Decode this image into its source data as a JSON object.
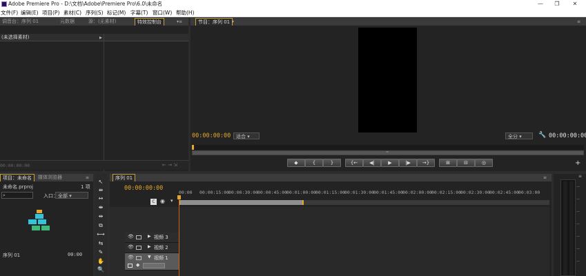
{
  "window": {
    "title": "Adobe Premiere Pro - D:\\文档\\Adobe\\Premiere Pro\\6.0\\未命名",
    "minimize": "—",
    "restore": "❐",
    "close": "✕"
  },
  "menu": [
    "文件(F)",
    "编辑(E)",
    "项目(P)",
    "素材(C)",
    "序列(S)",
    "标记(M)",
    "字幕(T)",
    "窗口(W)",
    "帮助(H)"
  ],
  "source_panel": {
    "tabs": [
      "调音台：序列 01",
      "元数据",
      "源：(无素材)",
      "特效控制台"
    ],
    "header": "(未选择素材)",
    "footer_tc": "00:00:00:00"
  },
  "program_monitor": {
    "tab": "节目：序列 01",
    "timecode_left": "00:00:00:00",
    "fit_dropdown": "适合",
    "quality_dropdown": "全分",
    "timecode_right": "00:00:00:00",
    "transport": [
      "◆",
      "{",
      "}",
      "{←",
      "◀|",
      "▶",
      "|▶",
      "→}",
      "⊞",
      "⊟",
      "◎"
    ]
  },
  "project_panel": {
    "tabs": [
      "项目：未命名",
      "媒体浏览器"
    ],
    "filename": "未命名.prproj",
    "count": "1 项",
    "search_placeholder": "",
    "entry_label": "入口：",
    "entry_value": "全部",
    "item_name": "序列 01",
    "item_duration": "00:00"
  },
  "tools": [
    "↖",
    "⇻",
    "↔",
    "⇼",
    "⇹",
    "⧉",
    "⟷",
    "⇆",
    "✎",
    "✋",
    "🔍"
  ],
  "timeline": {
    "tab": "序列 01",
    "timecode": "00:00:00:00",
    "ruler": [
      "00:00",
      "00:00:15:00",
      "00:00:30:00",
      "00:00:45:00",
      "00:01:00:00",
      "00:01:15:00",
      "00:01:30:00",
      "00:01:45:00",
      "00:02:00:00",
      "00:02:15:00",
      "00:02:30:00",
      "00:02:45:00",
      "00:03:00"
    ],
    "tracks": [
      "视频 3",
      "视频 2",
      "视频 1"
    ]
  },
  "colors": {
    "accent_orange": "#e5a82a",
    "panel_bg": "#232323",
    "tab_bg": "#3b3b3b",
    "active_tab_border": "#c9a13b"
  }
}
